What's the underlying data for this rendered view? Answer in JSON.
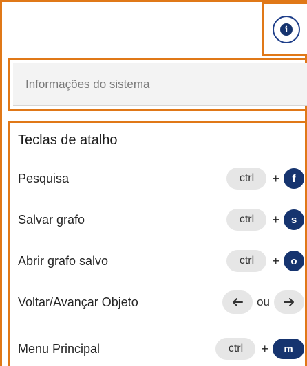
{
  "info_button": {
    "icon": "info-icon",
    "glyph": "i"
  },
  "system_info": {
    "label": "Informações do sistema"
  },
  "shortcuts": {
    "title": "Teclas de atalho",
    "rows": [
      {
        "label": "Pesquisa",
        "modifier": "ctrl",
        "joiner": "+",
        "key": "f"
      },
      {
        "label": "Salvar grafo",
        "modifier": "ctrl",
        "joiner": "+",
        "key": "s"
      },
      {
        "label": "Abrir grafo salvo",
        "modifier": "ctrl",
        "joiner": "+",
        "key": "o"
      },
      {
        "label": "Voltar/Avançar Objeto",
        "left_icon": "arrow-left-icon",
        "joiner": "ou",
        "right_icon": "arrow-right-icon"
      },
      {
        "label": "Menu Principal",
        "modifier": "ctrl",
        "joiner": "+",
        "key": "m"
      }
    ]
  },
  "colors": {
    "highlight": "#e07818",
    "key_accent": "#16346f",
    "pill_bg": "#e6e6e6",
    "field_bg": "#f3f3f3"
  }
}
